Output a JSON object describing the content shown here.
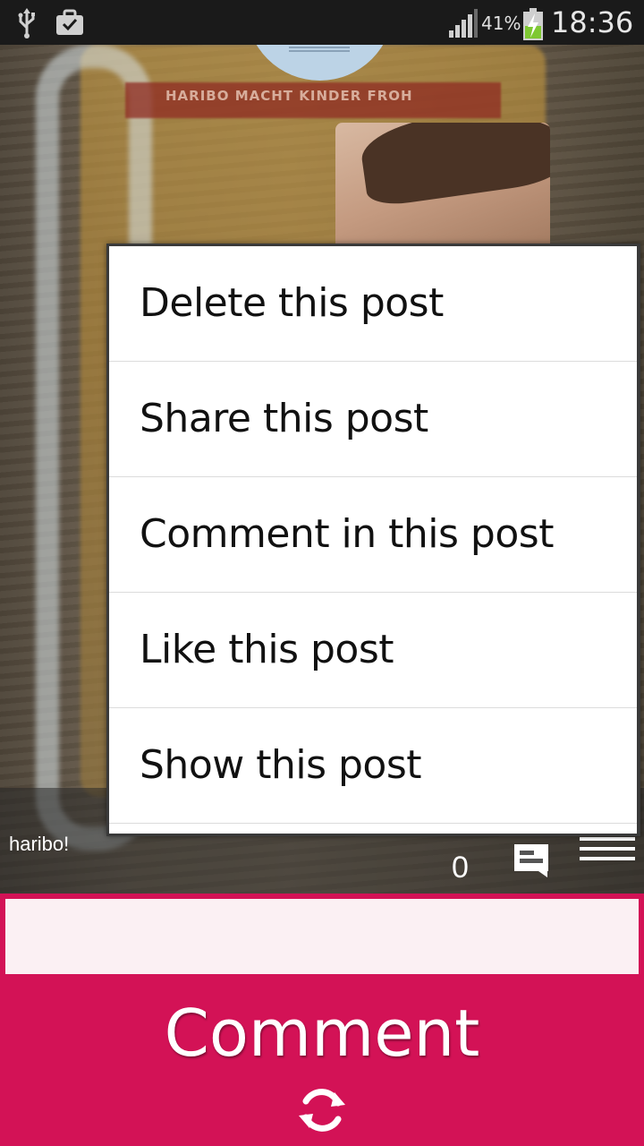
{
  "status_bar": {
    "battery_percent": "41%",
    "time": "18:36",
    "icons": [
      "usb-icon",
      "briefcase-check-icon",
      "signal-icon",
      "battery-charging-icon"
    ]
  },
  "post": {
    "caption": "haribo!",
    "comment_count": "0",
    "packet_text": "HARIBO MACHT KINDER FROH"
  },
  "popup_menu": {
    "items": [
      {
        "label": "Delete this post"
      },
      {
        "label": "Share this post"
      },
      {
        "label": "Comment in this post"
      },
      {
        "label": "Like this post"
      },
      {
        "label": "Show this post"
      }
    ]
  },
  "comment": {
    "input_value": "",
    "input_placeholder": "",
    "button_label": "Comment"
  },
  "colors": {
    "accent": "#d31256",
    "input_bg": "#fbf0f3",
    "status_bar_bg": "#1a1a1a"
  }
}
